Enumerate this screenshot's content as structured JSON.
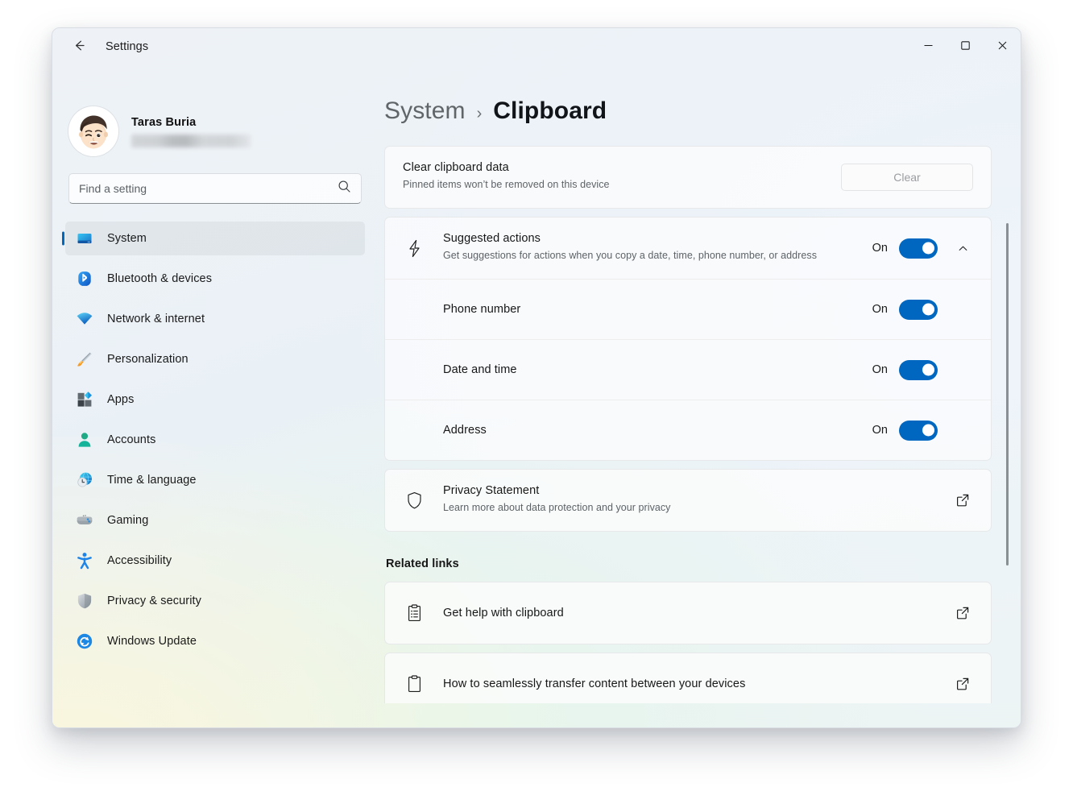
{
  "window": {
    "app_title": "Settings",
    "back_icon": "arrow-left-icon",
    "caption": {
      "minimize": "minimize-icon",
      "maximize": "maximize-icon",
      "close": "close-icon"
    }
  },
  "account": {
    "name": "Taras Buria",
    "email_redacted": true
  },
  "search": {
    "placeholder": "Find a setting",
    "value": "",
    "icon": "search-icon"
  },
  "sidebar": {
    "items": [
      {
        "label": "System",
        "icon": "monitor-icon",
        "selected": true
      },
      {
        "label": "Bluetooth & devices",
        "icon": "bluetooth-icon",
        "selected": false
      },
      {
        "label": "Network & internet",
        "icon": "wifi-icon",
        "selected": false
      },
      {
        "label": "Personalization",
        "icon": "paintbrush-icon",
        "selected": false
      },
      {
        "label": "Apps",
        "icon": "apps-grid-icon",
        "selected": false
      },
      {
        "label": "Accounts",
        "icon": "person-icon",
        "selected": false
      },
      {
        "label": "Time & language",
        "icon": "globe-clock-icon",
        "selected": false
      },
      {
        "label": "Gaming",
        "icon": "gamepad-icon",
        "selected": false
      },
      {
        "label": "Accessibility",
        "icon": "accessibility-icon",
        "selected": false
      },
      {
        "label": "Privacy & security",
        "icon": "shield-icon",
        "selected": false
      },
      {
        "label": "Windows Update",
        "icon": "update-refresh-icon",
        "selected": false
      }
    ]
  },
  "breadcrumb": {
    "parent": "System",
    "separator": "›",
    "current": "Clipboard"
  },
  "main": {
    "clear_clipboard": {
      "title": "Clear clipboard data",
      "subtitle": "Pinned items won’t be removed on this device",
      "button_label": "Clear"
    },
    "suggested_actions": {
      "icon": "lightning-bolt-icon",
      "title": "Suggested actions",
      "subtitle": "Get suggestions for actions when you copy a date, time, phone number, or address",
      "state": "On",
      "expander_icon": "chevron-up-icon",
      "expanded": true,
      "children": [
        {
          "title": "Phone number",
          "state": "On"
        },
        {
          "title": "Date and time",
          "state": "On"
        },
        {
          "title": "Address",
          "state": "On"
        }
      ]
    },
    "privacy_statement": {
      "icon": "shield-outline-icon",
      "title": "Privacy Statement",
      "subtitle": "Learn more about data protection and your privacy",
      "link_icon": "open-external-icon"
    },
    "related_links_heading": "Related links",
    "related_links": [
      {
        "title": "Get help with clipboard",
        "icon": "clipboard-list-icon",
        "link_icon": "open-external-icon"
      },
      {
        "title": "How to seamlessly transfer content between your devices",
        "icon": "clipboard-icon",
        "link_icon": "open-external-icon"
      }
    ]
  },
  "colors": {
    "accent": "#0067c0",
    "toggle_on": "#0067c0",
    "selection_bar": "#0067c0",
    "text_primary": "#171717",
    "text_secondary": "#5e6367",
    "card_bg": "#fdfdfd",
    "close_hover": "#c42b1c"
  }
}
